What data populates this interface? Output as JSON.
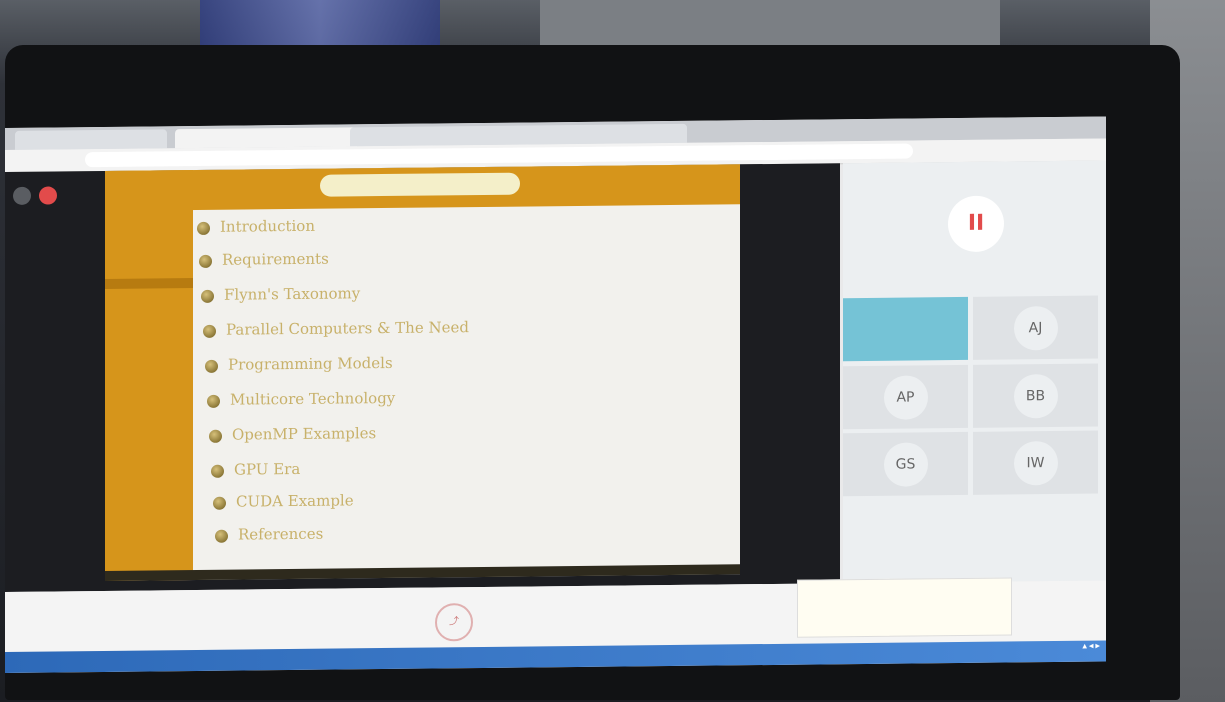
{
  "photo": {
    "description_tags": [
      "laptop",
      "google-meet",
      "slide-presentation"
    ]
  },
  "browser": {
    "tabs": [
      "",
      "",
      "",
      ""
    ],
    "url": ""
  },
  "slide": {
    "banner": "",
    "sidebar_title": "",
    "sidebar_subtitle": "",
    "sidebar_section": "",
    "sidebar_items": [
      "",
      "",
      "",
      "",
      "",
      "",
      "",
      "",
      "",
      ""
    ],
    "toc": [
      "Introduction",
      "Requirements",
      "Flynn's Taxonomy",
      "Parallel Computers & The Need",
      "Programming Models",
      "Multicore Technology",
      "OpenMP Examples",
      "GPU Era",
      "CUDA Example",
      "References"
    ],
    "footer": ""
  },
  "meet": {
    "pause_symbol": "II",
    "participants": [
      {
        "initials": "",
        "name": ""
      },
      {
        "initials": "AJ",
        "name": ""
      },
      {
        "initials": "AP",
        "name": ""
      },
      {
        "initials": "BB",
        "name": ""
      },
      {
        "initials": "GS",
        "name": ""
      },
      {
        "initials": "IW",
        "name": ""
      }
    ],
    "notification": ""
  },
  "colors": {
    "slide_accent": "#d6951b",
    "meet_highlight": "#75c3d6",
    "taskbar": "#2d69b8"
  }
}
